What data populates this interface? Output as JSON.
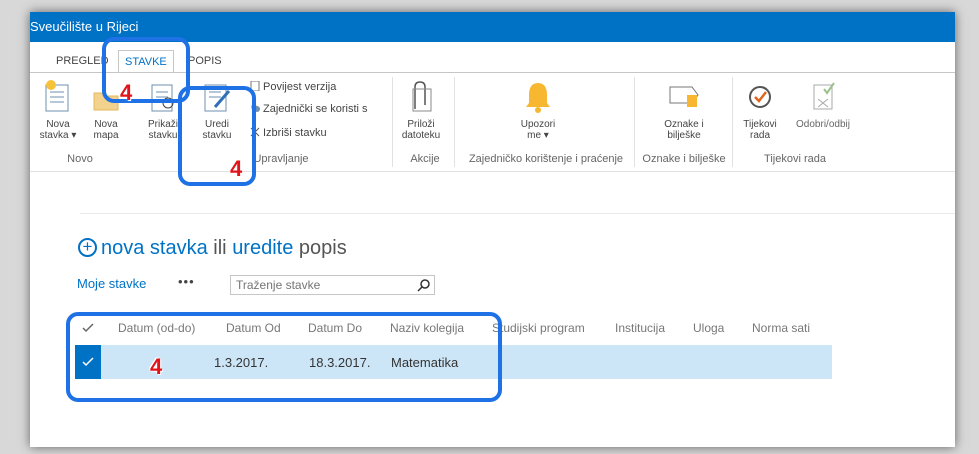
{
  "app": {
    "site_title": "Sveučilište u Rijeci"
  },
  "tabs": [
    {
      "label": "PREGLED"
    },
    {
      "label": "STAVKE"
    },
    {
      "label": "POPIS"
    }
  ],
  "ribbon": {
    "nova_stavka_l1": "Nova",
    "nova_stavka_l2": "stavka ▾",
    "nova_mapa_l1": "Nova",
    "nova_mapa_l2": "mapa",
    "prikazi_l1": "Prikaži",
    "prikazi_l2": "stavku",
    "uredi_l1": "Uredi",
    "uredi_l2": "stavku",
    "povijest": "Povijest verzija",
    "zajednicki": "Zajednički se koristi s",
    "izbrisi": "Izbriši stavku",
    "prilozi_l1": "Priloži",
    "prilozi_l2": "datoteku",
    "upozori_l1": "Upozori",
    "upozori_l2": "me ▾",
    "oznake_l1": "Oznake i",
    "oznake_l2": "bilješke",
    "tijekovi_l1": "Tijekovi",
    "tijekovi_l2": "rada",
    "odobri": "Odobri/odbij",
    "groups": {
      "novo": "Novo",
      "upravljanje": "Upravljanje",
      "akcije": "Akcije",
      "zajednicko": "Zajedničko korištenje i praćenje",
      "oznake": "Oznake i bilješke",
      "tijekovi": "Tijekovi rada"
    }
  },
  "list": {
    "new_item_plus": "+",
    "new_item_link": "nova stavka",
    "new_item_mid": " ili ",
    "edit_link": "uredite",
    "new_item_tail": " popis",
    "view_label": "Moje stavke",
    "more": "•••",
    "search_placeholder": "Traženje stavke",
    "columns": [
      "Datum (od-do)",
      "Datum Od",
      "Datum Do",
      "Naziv kolegija",
      "Studijski program",
      "Institucija",
      "Uloga",
      "Norma sati"
    ],
    "rows": [
      {
        "datum_od": "1.3.2017.",
        "datum_do": "18.3.2017.",
        "naziv": "Matematika"
      }
    ]
  },
  "annotations": {
    "step_number": "4"
  },
  "colors": {
    "suitebar": "#0072c6",
    "highlight": "#1e72e6",
    "annotation": "#e0141a",
    "selected_row": "#cde6f7"
  }
}
